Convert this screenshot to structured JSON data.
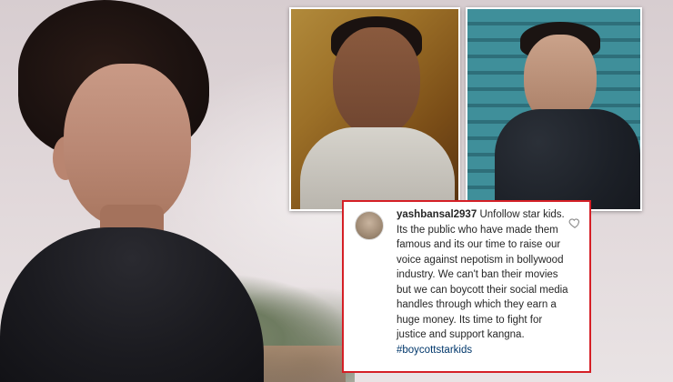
{
  "comment": {
    "username": "yashbansal2937",
    "text": "Unfollow star kids. Its the public who have made them famous and its our time to raise our voice against nepotism in bollywood industry. We can't ban their movies but we can boycott their social media handles through which they earn a huge money. Its time to fight for justice and support kangna.",
    "hashtag": "#boycottstarkids"
  },
  "colors": {
    "card_border": "#d51f26",
    "hashtag": "#00376b",
    "text": "#262626"
  },
  "icons": {
    "like": "heart-outline-icon",
    "avatar": "user-avatar"
  }
}
